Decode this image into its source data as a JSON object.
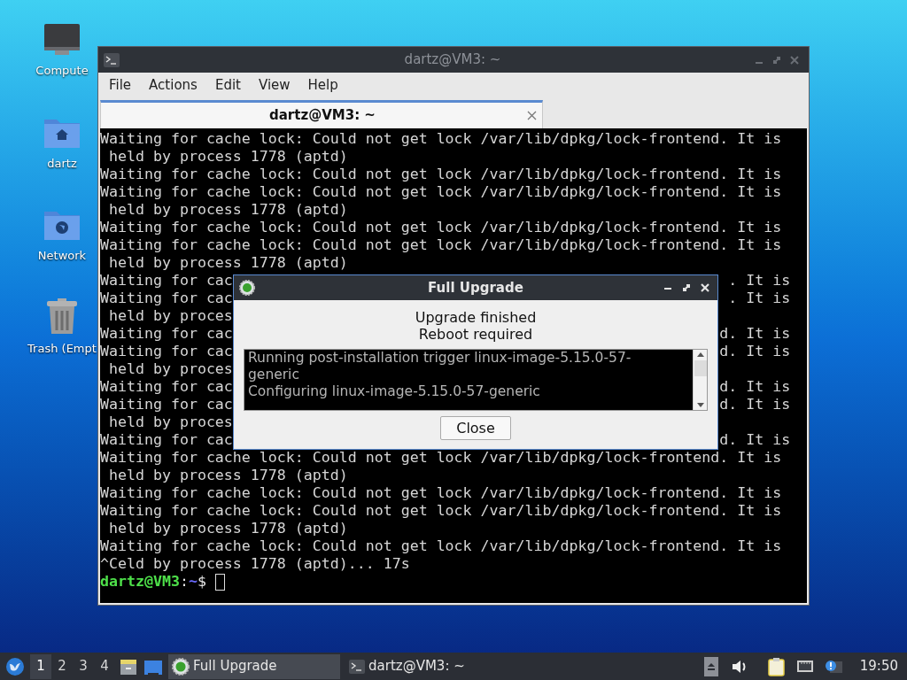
{
  "desktop_icons": [
    {
      "label": "Compute",
      "kind": "monitor"
    },
    {
      "label": "dartz",
      "kind": "home"
    },
    {
      "label": "Network",
      "kind": "network"
    },
    {
      "label": "Trash (Empt",
      "kind": "trash"
    }
  ],
  "terminal": {
    "title": "dartz@VM3: ~",
    "menu": [
      "File",
      "Actions",
      "Edit",
      "View",
      "Help"
    ],
    "tab": {
      "label": "dartz@VM3: ~",
      "selected": true
    },
    "lines": [
      {
        "text": "Waiting for cache lock: Could not get lock /var/lib/dpkg/lock-frontend. It is"
      },
      {
        "text": " held by process 1778 (aptd)"
      },
      {
        "text": "Waiting for cache lock: Could not get lock /var/lib/dpkg/lock-frontend. It is"
      },
      {
        "text": "Waiting for cache lock: Could not get lock /var/lib/dpkg/lock-frontend. It is"
      },
      {
        "text": " held by process 1778 (aptd)"
      },
      {
        "text": "Waiting for cache lock: Could not get lock /var/lib/dpkg/lock-frontend. It is"
      },
      {
        "text": "Waiting for cache lock: Could not get lock /var/lib/dpkg/lock-frontend. It is"
      },
      {
        "text": " held by process 1778 (aptd)"
      },
      {
        "text": "Waiting for cac",
        "right": ". It is"
      },
      {
        "text": "Waiting for cac",
        "right": ". It is"
      },
      {
        "text": " held by proces"
      },
      {
        "text": "Waiting for cac",
        "right": "d. It is"
      },
      {
        "text": "Waiting for cac",
        "right": "d. It is"
      },
      {
        "text": " held by proces"
      },
      {
        "text": "Waiting for cac",
        "right": "d. It is"
      },
      {
        "text": "Waiting for cac",
        "right": "d. It is"
      },
      {
        "text": " held by proces"
      },
      {
        "text": "Waiting for cac",
        "right": "d. It is"
      },
      {
        "text": "Waiting for cache lock: Could not get lock /var/lib/dpkg/lock-frontend. It is"
      },
      {
        "text": " held by process 1778 (aptd)"
      },
      {
        "text": "Waiting for cache lock: Could not get lock /var/lib/dpkg/lock-frontend. It is"
      },
      {
        "text": "Waiting for cache lock: Could not get lock /var/lib/dpkg/lock-frontend. It is"
      },
      {
        "text": " held by process 1778 (aptd)"
      },
      {
        "text": "Waiting for cache lock: Could not get lock /var/lib/dpkg/lock-frontend. It is"
      },
      {
        "text": "^Celd by process 1778 (aptd)... 17s"
      }
    ],
    "prompt": {
      "user_host": "dartz@VM3",
      "separator": ":",
      "path": "~",
      "symbol": "$"
    }
  },
  "dialog": {
    "title": "Full Upgrade",
    "messages": [
      "Upgrade finished",
      "Reboot required"
    ],
    "log": [
      "Running post-installation trigger linux-image-5.15.0-57-generic",
      "Configuring linux-image-5.15.0-57-generic"
    ],
    "button": "Close"
  },
  "taskbar": {
    "workspaces": [
      {
        "label": "1",
        "selected": true
      },
      {
        "label": "2",
        "selected": false
      },
      {
        "label": "3",
        "selected": false
      },
      {
        "label": "4",
        "selected": false
      }
    ],
    "tasks": [
      {
        "label": "Full Upgrade",
        "kind": "upgrade",
        "selected": true
      },
      {
        "label": "dartz@VM3: ~",
        "kind": "terminal",
        "selected": false
      }
    ],
    "clock": "19:50"
  }
}
